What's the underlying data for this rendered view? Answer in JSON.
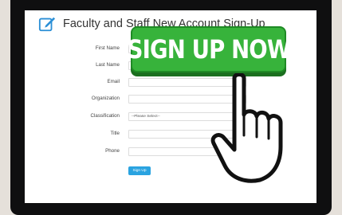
{
  "page": {
    "title": "Faculty and Staff New Account Sign-Up"
  },
  "form": {
    "fields": [
      {
        "label": "First Name",
        "value": "",
        "placeholder": ""
      },
      {
        "label": "Last Name",
        "value": "",
        "placeholder": ""
      },
      {
        "label": "Email",
        "value": "",
        "placeholder": ""
      },
      {
        "label": "Organization",
        "value": "",
        "placeholder": ""
      },
      {
        "label": "Classification",
        "selected": "--Please Select--"
      },
      {
        "label": "Title",
        "value": "",
        "placeholder": ""
      },
      {
        "label": "Phone",
        "value": "",
        "placeholder": ""
      }
    ],
    "submit_label": "Sign Up"
  },
  "banner": {
    "text": "SIGN UP NOW",
    "color": "#37b33b"
  },
  "icons": {
    "edit": "edit-icon",
    "hand": "pointing-hand-icon",
    "caret": "select-caret-icon"
  },
  "colors": {
    "button": "#2aa3e0",
    "title_icon": "#2b8fd6"
  }
}
